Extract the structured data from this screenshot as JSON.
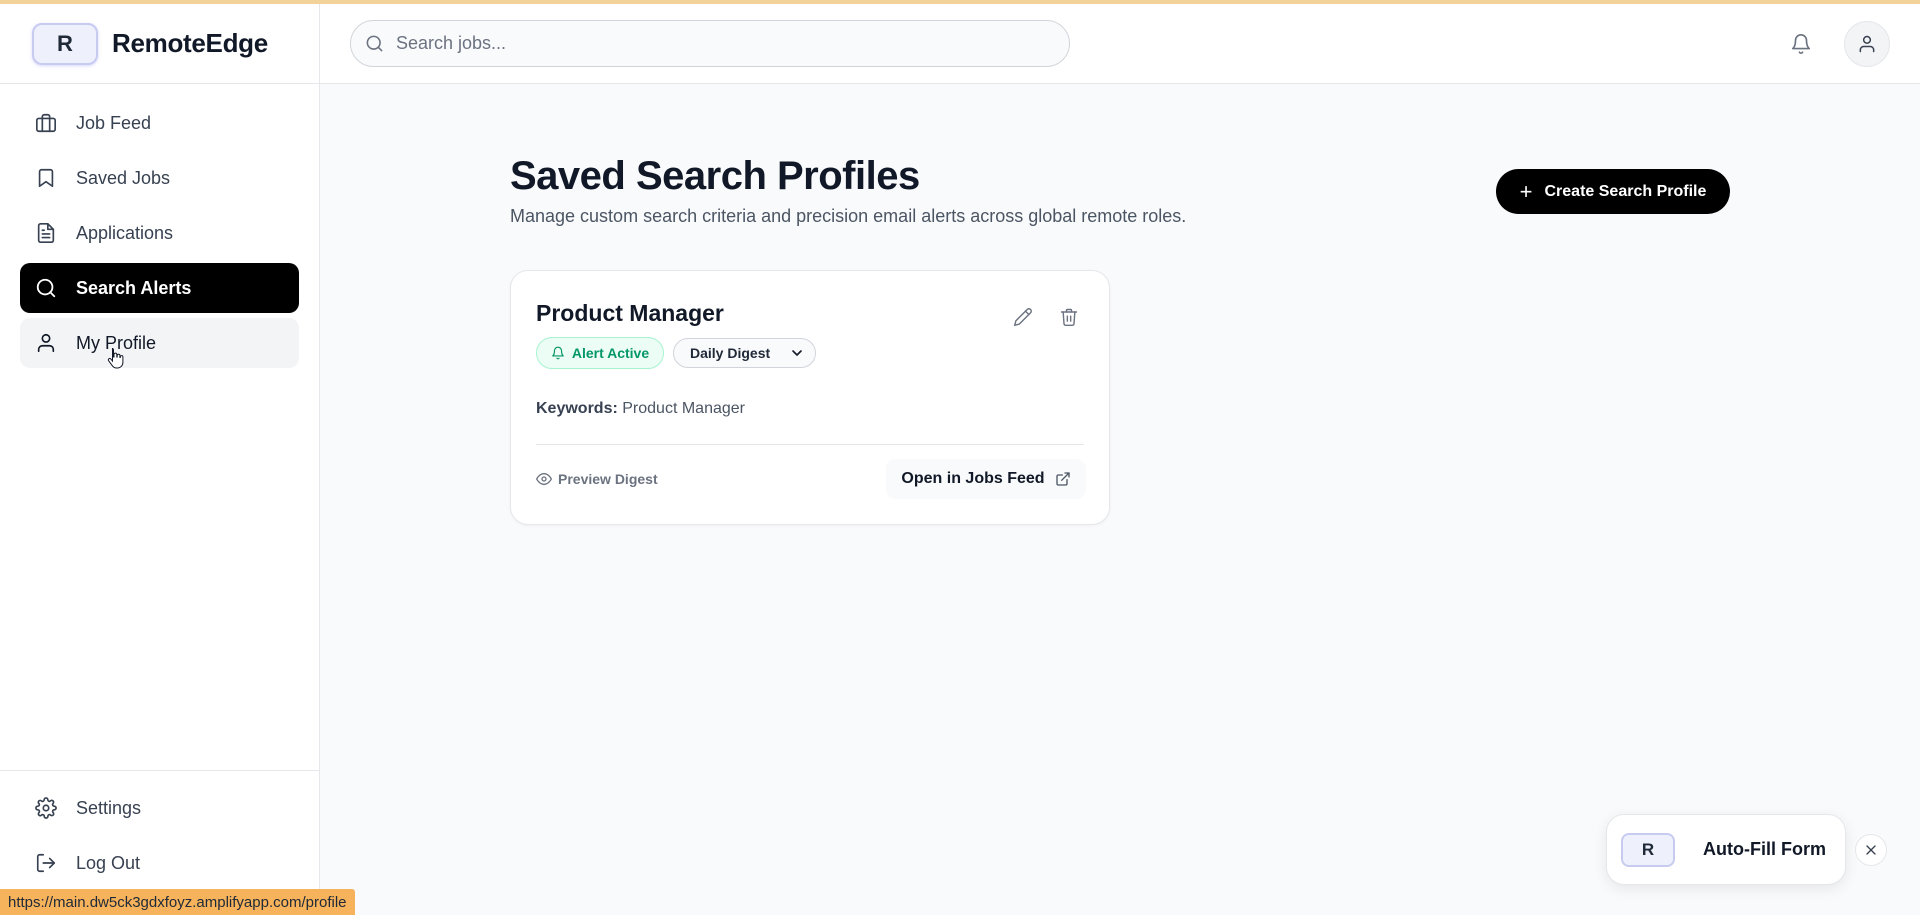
{
  "brand": {
    "logo_letter": "R",
    "name": "RemoteEdge"
  },
  "search": {
    "placeholder": "Search jobs..."
  },
  "sidebar": {
    "items": [
      {
        "label": "Job Feed",
        "icon": "briefcase-icon"
      },
      {
        "label": "Saved Jobs",
        "icon": "bookmark-icon"
      },
      {
        "label": "Applications",
        "icon": "document-icon"
      },
      {
        "label": "Search Alerts",
        "icon": "search-icon",
        "active": true
      },
      {
        "label": "My Profile",
        "icon": "user-icon",
        "hovered": true
      }
    ],
    "bottom": [
      {
        "label": "Settings",
        "icon": "gear-icon"
      },
      {
        "label": "Log Out",
        "icon": "logout-icon"
      }
    ]
  },
  "main": {
    "title": "Saved Search Profiles",
    "subtitle": "Manage custom search criteria and precision email alerts across global remote roles.",
    "create_button": "Create Search Profile"
  },
  "profiles": [
    {
      "title": "Product Manager",
      "status": "Alert Active",
      "frequency": "Daily Digest",
      "keywords_label": "Keywords:",
      "keywords_value": "Product Manager",
      "preview_label": "Preview Digest",
      "open_label": "Open in Jobs Feed"
    }
  ],
  "autofill": {
    "logo_letter": "R",
    "label": "Auto-Fill Form"
  },
  "status_bar": {
    "url": "https://main.dw5ck3gdxfoyz.amplifyapp.com/profile"
  },
  "colors": {
    "accent": "#000000",
    "active_green": "#059669",
    "status_bar": "#f6b35b"
  }
}
